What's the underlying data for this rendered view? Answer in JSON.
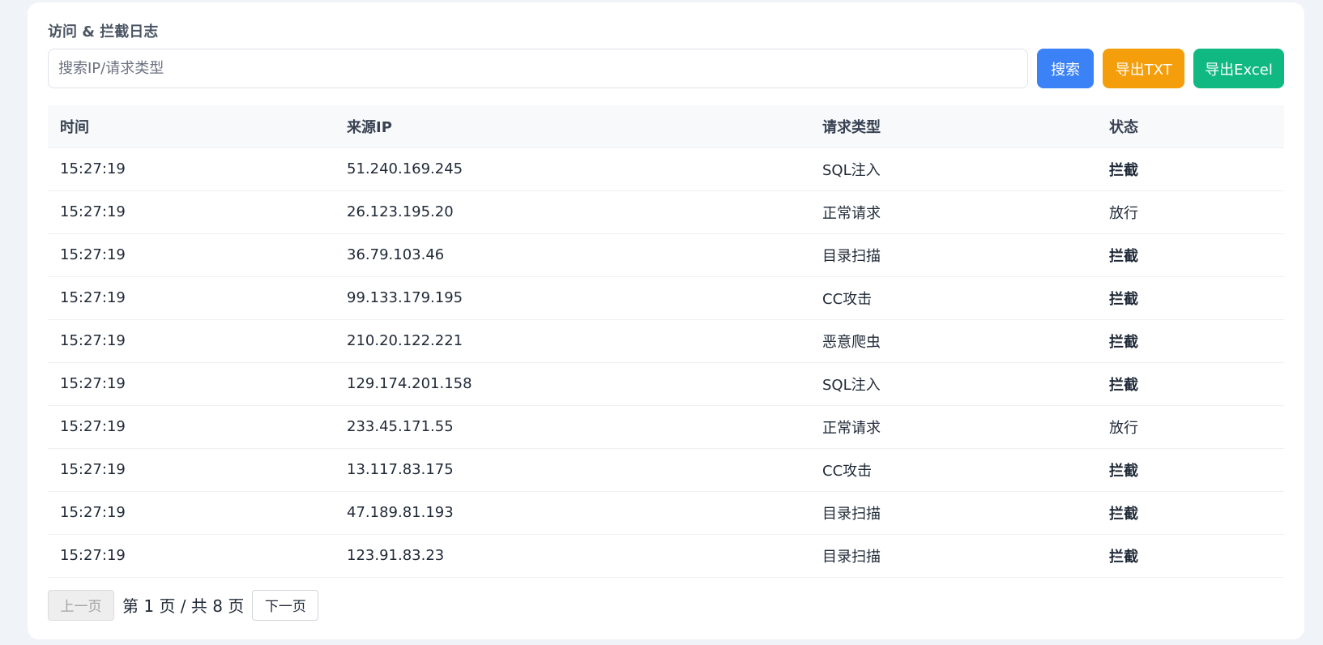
{
  "card": {
    "title": "访问 & 拦截日志"
  },
  "search": {
    "placeholder": "搜索IP/请求类型",
    "value": ""
  },
  "toolbar": {
    "search_label": "搜索",
    "export_txt_label": "导出TXT",
    "export_excel_label": "导出Excel"
  },
  "table": {
    "headers": [
      "时间",
      "来源IP",
      "请求类型",
      "状态"
    ],
    "rows": [
      {
        "time": "15:27:19",
        "ip": "51.240.169.245",
        "type": "SQL注入",
        "status": "拦截",
        "blocked": true
      },
      {
        "time": "15:27:19",
        "ip": "26.123.195.20",
        "type": "正常请求",
        "status": "放行",
        "blocked": false
      },
      {
        "time": "15:27:19",
        "ip": "36.79.103.46",
        "type": "目录扫描",
        "status": "拦截",
        "blocked": true
      },
      {
        "time": "15:27:19",
        "ip": "99.133.179.195",
        "type": "CC攻击",
        "status": "拦截",
        "blocked": true
      },
      {
        "time": "15:27:19",
        "ip": "210.20.122.221",
        "type": "恶意爬虫",
        "status": "拦截",
        "blocked": true
      },
      {
        "time": "15:27:19",
        "ip": "129.174.201.158",
        "type": "SQL注入",
        "status": "拦截",
        "blocked": true
      },
      {
        "time": "15:27:19",
        "ip": "233.45.171.55",
        "type": "正常请求",
        "status": "放行",
        "blocked": false
      },
      {
        "time": "15:27:19",
        "ip": "13.117.83.175",
        "type": "CC攻击",
        "status": "拦截",
        "blocked": true
      },
      {
        "time": "15:27:19",
        "ip": "47.189.81.193",
        "type": "目录扫描",
        "status": "拦截",
        "blocked": true
      },
      {
        "time": "15:27:19",
        "ip": "123.91.83.23",
        "type": "目录扫描",
        "status": "拦截",
        "blocked": true
      }
    ]
  },
  "pagination": {
    "prev_label": "上一页",
    "next_label": "下一页",
    "page_info": "第 1 页 / 共 8 页"
  },
  "colors": {
    "search": "#3b82f6",
    "export_txt": "#f59e0b",
    "export_excel": "#10b981",
    "status_blocked": "#ef4444",
    "status_passed": "#10b981"
  }
}
